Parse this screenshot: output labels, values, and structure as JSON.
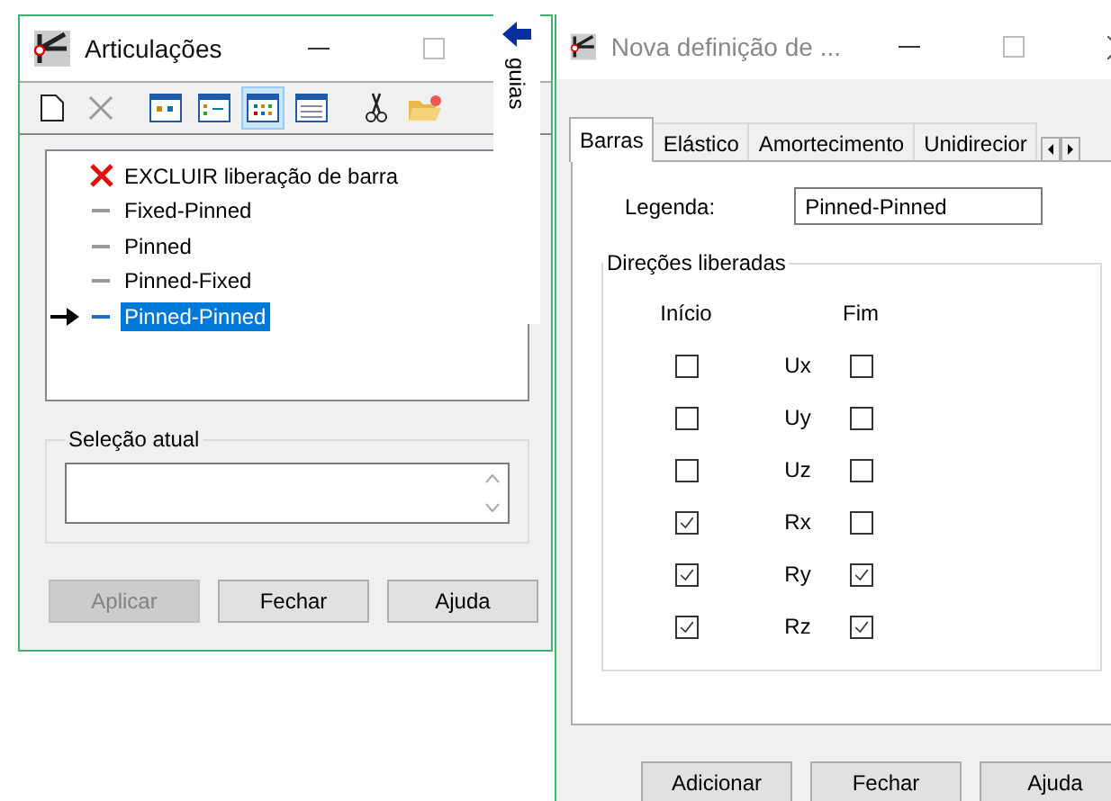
{
  "left_window": {
    "title": "Articulações",
    "toolbar": [
      {
        "kind": "new",
        "selected": false
      },
      {
        "kind": "delete",
        "selected": false
      },
      {
        "kind": "view-large",
        "selected": false
      },
      {
        "kind": "view-small",
        "selected": false
      },
      {
        "kind": "view-grid",
        "selected": true
      },
      {
        "kind": "view-details",
        "selected": false
      },
      {
        "kind": "cut",
        "selected": false
      },
      {
        "kind": "open",
        "selected": false
      }
    ],
    "tree_items": [
      {
        "label": "EXCLUIR liberação de barra",
        "kind": "delete",
        "selected": false
      },
      {
        "label": "Fixed-Pinned",
        "kind": "release",
        "selected": false
      },
      {
        "label": "Pinned",
        "kind": "release",
        "selected": false
      },
      {
        "label": "Pinned-Fixed",
        "kind": "release",
        "selected": false
      },
      {
        "label": "Pinned-Pinned",
        "kind": "release",
        "selected": true
      }
    ],
    "current_selection": {
      "title": "Seleção atual"
    },
    "buttons": [
      {
        "label": "Aplicar",
        "disabled": true
      },
      {
        "label": "Fechar",
        "disabled": false
      },
      {
        "label": "Ajuda",
        "disabled": false
      }
    ]
  },
  "side_tab": {
    "label": "guias"
  },
  "right_window": {
    "title": "Nova definição de ...",
    "tabs": [
      {
        "label": "Barras",
        "selected": true
      },
      {
        "label": "Elástico",
        "selected": false
      },
      {
        "label": "Amortecimento",
        "selected": false
      },
      {
        "label": "Unidirecior",
        "selected": false
      }
    ],
    "legend": {
      "label": "Legenda:",
      "value": "Pinned-Pinned"
    },
    "group": {
      "title": "Direções liberadas",
      "columns": [
        "Início",
        "Fim"
      ],
      "rows": [
        {
          "label": "Ux",
          "start": false,
          "end": false
        },
        {
          "label": "Uy",
          "start": false,
          "end": false
        },
        {
          "label": "Uz",
          "start": false,
          "end": false
        },
        {
          "label": "Rx",
          "start": true,
          "end": false
        },
        {
          "label": "Ry",
          "start": true,
          "end": true
        },
        {
          "label": "Rz",
          "start": true,
          "end": true
        }
      ]
    },
    "buttons": [
      {
        "label": "Adicionar",
        "disabled": false
      },
      {
        "label": "Fechar",
        "disabled": false
      },
      {
        "label": "Ajuda",
        "disabled": false
      }
    ]
  }
}
